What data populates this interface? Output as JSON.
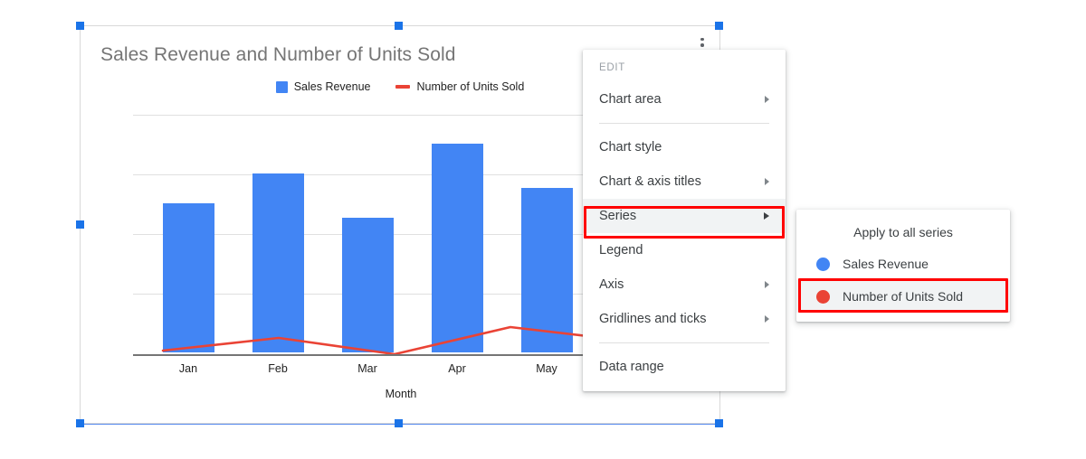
{
  "chart": {
    "title": "Sales Revenue and Number of Units Sold",
    "legend": [
      {
        "label": "Sales Revenue",
        "marker": "square-swatch-icon",
        "color": "#4285f4"
      },
      {
        "label": "Number of Units Sold",
        "marker": "line-swatch-icon",
        "color": "#ea4335"
      }
    ],
    "kebab_icon": "more-vert-icon"
  },
  "chart_data": {
    "type": "bar",
    "title": "Sales Revenue and Number of Units Sold",
    "xlabel": "Month",
    "ylabel": "",
    "categories": [
      "Jan",
      "Feb",
      "Mar",
      "Apr",
      "May"
    ],
    "yticks": [
      "0",
      "2000",
      "4000",
      "6000",
      "8000"
    ],
    "ylim": [
      0,
      8000
    ],
    "grid": true,
    "legend_position": "top",
    "series": [
      {
        "name": "Sales Revenue",
        "type": "bar",
        "color": "#4285f4",
        "values": [
          5000,
          6000,
          4500,
          7000,
          5500
        ]
      },
      {
        "name": "Number of Units Sold",
        "type": "line",
        "color": "#ea4335",
        "values": [
          120,
          550,
          60,
          900,
          420
        ]
      }
    ]
  },
  "menu": {
    "section_label": "EDIT",
    "items": [
      {
        "label": "Chart area",
        "has_arrow": true,
        "active": false,
        "divider_after": true
      },
      {
        "label": "Chart style",
        "has_arrow": false,
        "active": false,
        "divider_after": false
      },
      {
        "label": "Chart & axis titles",
        "has_arrow": true,
        "active": false,
        "divider_after": false
      },
      {
        "label": "Series",
        "has_arrow": true,
        "active": true,
        "divider_after": false
      },
      {
        "label": "Legend",
        "has_arrow": false,
        "active": false,
        "divider_after": false
      },
      {
        "label": "Axis",
        "has_arrow": true,
        "active": false,
        "divider_after": false
      },
      {
        "label": "Gridlines and ticks",
        "has_arrow": true,
        "active": false,
        "divider_after": true
      },
      {
        "label": "Data range",
        "has_arrow": false,
        "active": false,
        "divider_after": false
      }
    ]
  },
  "submenu": {
    "header": "Apply to all series",
    "items": [
      {
        "label": "Sales Revenue",
        "color": "#4285f4",
        "active": false
      },
      {
        "label": "Number of Units Sold",
        "color": "#ea4335",
        "active": true
      }
    ]
  },
  "annotations": {
    "highlight_color": "#ff0000",
    "boxes": [
      "series-menu-item",
      "number-of-units-sold-series-item"
    ]
  }
}
